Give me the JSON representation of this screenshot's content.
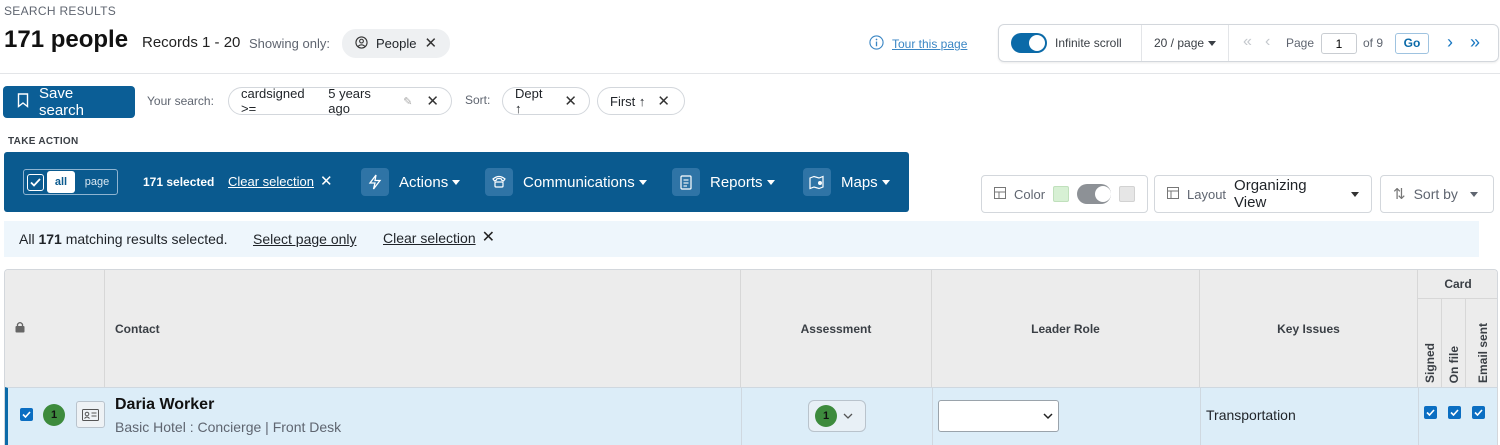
{
  "header": {
    "section_label": "SEARCH RESULTS",
    "count_title": "171 people",
    "records_range": "Records 1 - 20",
    "showing_only_label": "Showing only:",
    "filter_chip": "People",
    "tour_link": "Tour this page"
  },
  "pager": {
    "infinite_scroll_label": "Infinite scroll",
    "infinite_scroll_on": true,
    "per_page": "20 / page",
    "page_label": "Page",
    "page_value": "1",
    "of_pages": "of 9",
    "go_label": "Go"
  },
  "search": {
    "save_label": "Save search",
    "your_search_label": "Your search:",
    "criteria_field": "cardsigned >=",
    "criteria_value": "5 years ago",
    "sort_label": "Sort:",
    "sorts": [
      {
        "label": "Dept ↑"
      },
      {
        "label": "First ↑"
      }
    ]
  },
  "take_action": {
    "label": "TAKE ACTION",
    "all_label": "all",
    "page_label": "page",
    "selected_count": "171 selected",
    "clear_selection": "Clear selection",
    "menus": {
      "actions": "Actions",
      "communications": "Communications",
      "reports": "Reports",
      "maps": "Maps"
    }
  },
  "view_controls": {
    "color_label": "Color",
    "layout_label": "Layout",
    "layout_value": "Organizing View",
    "sort_by": "Sort by"
  },
  "selection_banner": {
    "prefix": "All",
    "count": "171",
    "suffix": "matching results selected.",
    "select_page_only": "Select page only",
    "clear_selection": "Clear selection"
  },
  "table": {
    "columns": {
      "contact": "Contact",
      "assessment": "Assessment",
      "leader_role": "Leader Role",
      "key_issues": "Key Issues",
      "card_group": "Card",
      "signed": "Signed",
      "on_file": "On file",
      "email_sent": "Email sent"
    },
    "rows": [
      {
        "badge": "1",
        "name": "Daria Worker",
        "detail": "Basic Hotel : Concierge | Front Desk",
        "assessment": "1",
        "leader_role": "",
        "key_issues": "Transportation",
        "signed": true,
        "on_file": true,
        "email_sent": true
      }
    ]
  },
  "colors": {
    "brand_blue": "#0a5a8f",
    "button_blue": "#0b5e96",
    "badge_green": "#3d8b3d",
    "row_highlight": "#dcedf8",
    "banner_bg": "#eef6fc"
  }
}
